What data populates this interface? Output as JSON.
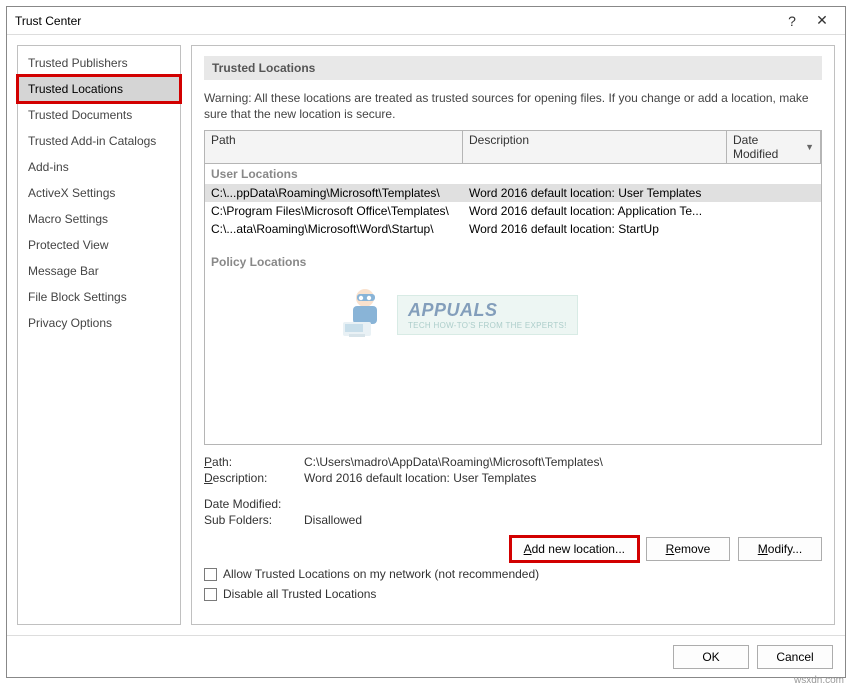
{
  "titlebar": {
    "title": "Trust Center",
    "help": "?",
    "close": "✕"
  },
  "sidebar": {
    "items": [
      {
        "label": "Trusted Publishers"
      },
      {
        "label": "Trusted Locations",
        "selected": true
      },
      {
        "label": "Trusted Documents"
      },
      {
        "label": "Trusted Add-in Catalogs"
      },
      {
        "label": "Add-ins"
      },
      {
        "label": "ActiveX Settings"
      },
      {
        "label": "Macro Settings"
      },
      {
        "label": "Protected View"
      },
      {
        "label": "Message Bar"
      },
      {
        "label": "File Block Settings"
      },
      {
        "label": "Privacy Options"
      }
    ]
  },
  "main": {
    "heading": "Trusted Locations",
    "warning": "Warning: All these locations are treated as trusted sources for opening files.  If you change or add a location, make sure that the new location is secure.",
    "columns": {
      "path": "Path",
      "desc": "Description",
      "date": "Date Modified"
    },
    "group_user": "User Locations",
    "group_policy": "Policy Locations",
    "rows": [
      {
        "path": "C:\\...ppData\\Roaming\\Microsoft\\Templates\\",
        "desc": "Word 2016 default location: User Templates",
        "selected": true
      },
      {
        "path": "C:\\Program Files\\Microsoft Office\\Templates\\",
        "desc": "Word 2016 default location: Application Te..."
      },
      {
        "path": "C:\\...ata\\Roaming\\Microsoft\\Word\\Startup\\",
        "desc": "Word 2016 default location: StartUp"
      }
    ],
    "details": {
      "path_label": "Path:",
      "path_value": "C:\\Users\\madro\\AppData\\Roaming\\Microsoft\\Templates\\",
      "desc_label": "Description:",
      "desc_value": "Word 2016 default location: User Templates",
      "date_label": "Date Modified:",
      "date_value": "",
      "sub_label": "Sub Folders:",
      "sub_value": "Disallowed"
    },
    "buttons": {
      "add": "Add new location...",
      "remove": "Remove",
      "modify": "Modify..."
    },
    "checks": {
      "network": "Allow Trusted Locations on my network (not recommended)",
      "disable": "Disable all Trusted Locations"
    }
  },
  "footer": {
    "ok": "OK",
    "cancel": "Cancel"
  },
  "watermark": {
    "brand": "APPUALS",
    "tag": "TECH HOW-TO'S FROM THE EXPERTS!"
  },
  "attribution": "wsxdn.com"
}
